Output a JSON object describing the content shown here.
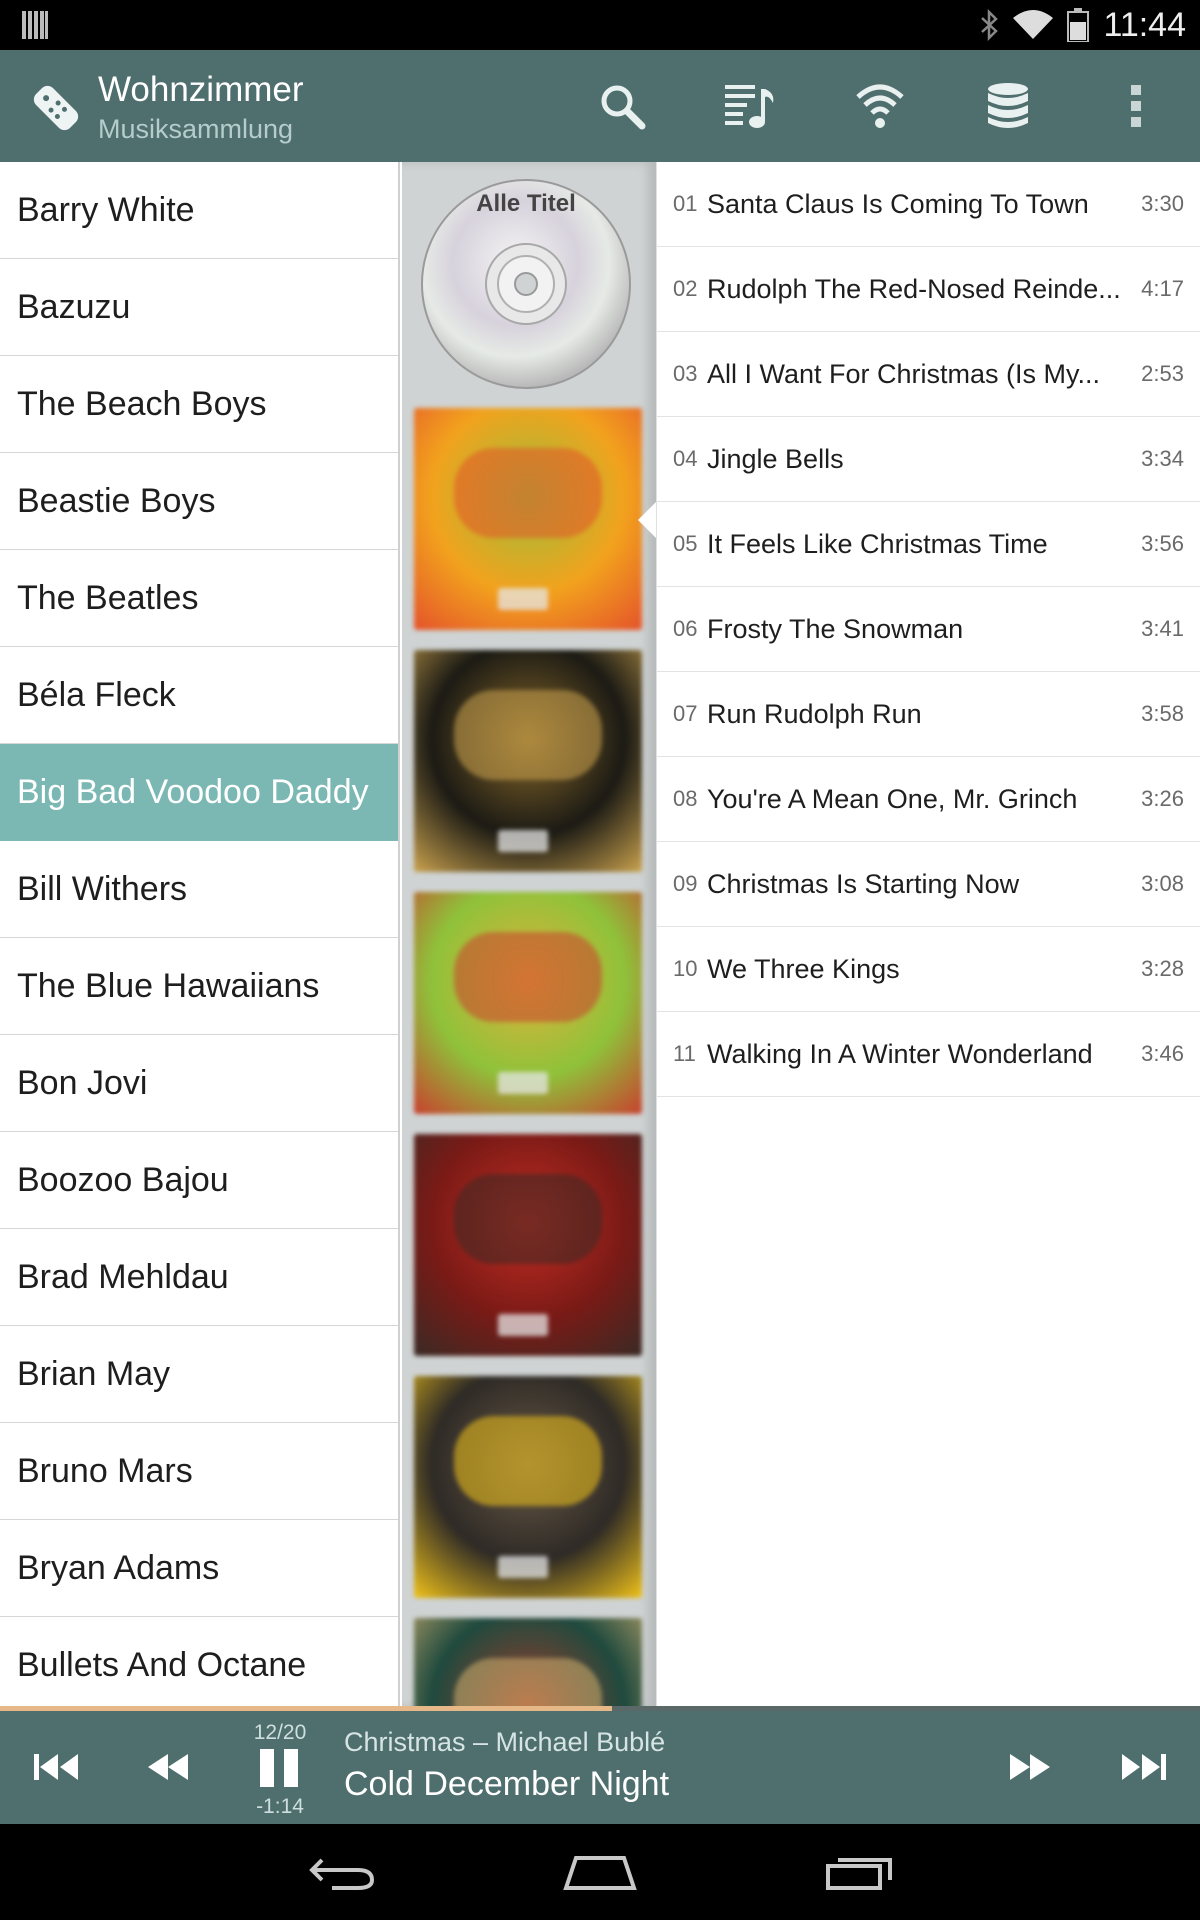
{
  "status": {
    "time": "11:44"
  },
  "app": {
    "title": "Wohnzimmer",
    "subtitle": "Musiksammlung",
    "icons": [
      "remote-icon",
      "search-icon",
      "queue-music-icon",
      "wifi-icon",
      "database-icon",
      "overflow-menu-icon"
    ]
  },
  "artists": [
    "Barry White",
    "Bazuzu",
    "The Beach Boys",
    "Beastie Boys",
    "The Beatles",
    "Béla Fleck",
    "Big Bad Voodoo Daddy",
    "Bill Withers",
    "The Blue Hawaiians",
    "Bon Jovi",
    "Boozoo Bajou",
    "Brad Mehldau",
    "Brian May",
    "Bruno Mars",
    "Bryan Adams",
    "Bullets And Octane"
  ],
  "selected_artist": "Big Bad Voodoo Daddy",
  "albums": {
    "all_titles_label": "Alle Titel",
    "cover_colors": [
      [
        "#f2a21d",
        "#9bbe3a",
        "#e4532a"
      ],
      [
        "#1b1a14",
        "#8a6a2a",
        "#caa24e"
      ],
      [
        "#8fc23a",
        "#e2b13a",
        "#c8412e"
      ],
      [
        "#7a1a16",
        "#c42c22",
        "#3a2a24"
      ],
      [
        "#2e2a26",
        "#6a5a46",
        "#f0c21a"
      ],
      [
        "#1f4a3e",
        "#a33c2a",
        "#d0b070"
      ]
    ]
  },
  "tracks": [
    {
      "num": "01",
      "title": "Santa Claus Is Coming To Town",
      "duration": "3:30"
    },
    {
      "num": "02",
      "title": "Rudolph The Red-Nosed Reinde...",
      "duration": "4:17"
    },
    {
      "num": "03",
      "title": "All I Want For Christmas (Is My...",
      "duration": "2:53"
    },
    {
      "num": "04",
      "title": "Jingle Bells",
      "duration": "3:34"
    },
    {
      "num": "05",
      "title": "It Feels Like Christmas Time",
      "duration": "3:56"
    },
    {
      "num": "06",
      "title": "Frosty The Snowman",
      "duration": "3:41"
    },
    {
      "num": "07",
      "title": "Run Rudolph Run",
      "duration": "3:58"
    },
    {
      "num": "08",
      "title": "You're A Mean One, Mr. Grinch",
      "duration": "3:26"
    },
    {
      "num": "09",
      "title": "Christmas Is Starting Now",
      "duration": "3:08"
    },
    {
      "num": "10",
      "title": "We Three Kings",
      "duration": "3:28"
    },
    {
      "num": "11",
      "title": "Walking In A Winter Wonderland",
      "duration": "3:46"
    }
  ],
  "player": {
    "position": "12/20",
    "remaining": "-1:14",
    "album_artist": "Christmas – Michael Bublé",
    "song": "Cold December Night",
    "progress_fraction": 0.51
  },
  "colors": {
    "header": "#4f6e6e",
    "selected": "#7bb8b4",
    "progress": "#e6b887"
  }
}
